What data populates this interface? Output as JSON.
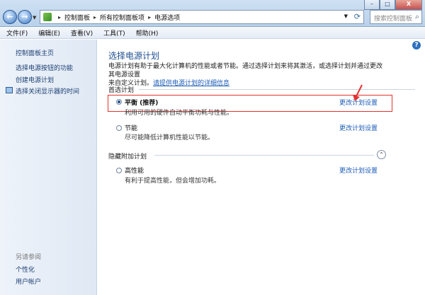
{
  "window": {
    "minimize_glyph": "–",
    "maximize_glyph": "□",
    "close_glyph": "X"
  },
  "nav": {
    "back_glyph": "←",
    "forward_glyph": "→"
  },
  "address": {
    "crumbs": [
      "控制面板",
      "所有控制面板项",
      "电源选项"
    ],
    "separator": "▸"
  },
  "search": {
    "placeholder": "搜索控制面板"
  },
  "menu": {
    "items": [
      "文件(F)",
      "编辑(E)",
      "查看(V)",
      "工具(T)",
      "帮助(H)"
    ]
  },
  "sidebar": {
    "items": [
      {
        "label": "控制面板主页"
      },
      {
        "label": "选择电源按钮的功能"
      },
      {
        "label": "创建电源计划"
      },
      {
        "label": "选择关闭显示器的时间"
      }
    ],
    "see_also_heading": "另请参阅",
    "see_also_items": [
      {
        "label": "个性化"
      },
      {
        "label": "用户帐户"
      }
    ]
  },
  "main": {
    "title": "选择电源计划",
    "desc_line1": "电源计划有助于最大化计算机的性能或者节能。通过选择计划来将其激活，或选择计划并通过更改其电源设置",
    "desc_line2_prefix": "来自定义计划。",
    "desc_link": "请提供电源计划的详细信息",
    "preferred_heading": "首选计划",
    "hidden_heading": "隐藏附加计划",
    "collapse_glyph": "⌃",
    "change_label": "更改计划设置",
    "plans": [
      {
        "name": "平衡 (推荐)",
        "desc": "利用可用的硬件自动平衡功耗与性能。",
        "selected": true
      },
      {
        "name": "节能",
        "desc": "尽可能降低计算机性能以节能。",
        "selected": false
      },
      {
        "name": "高性能",
        "desc": "有利于提高性能，但会增加功耗。",
        "selected": false
      }
    ]
  },
  "colors": {
    "accent": "#1d4f91",
    "link": "#1c5cb8",
    "highlight_border": "#e0322f"
  }
}
